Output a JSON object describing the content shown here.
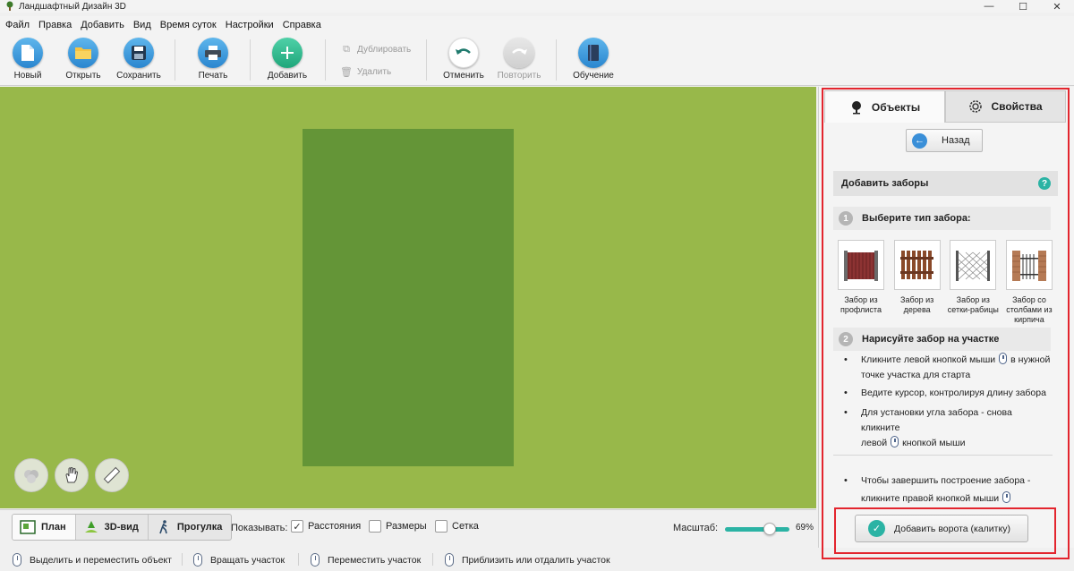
{
  "window": {
    "title": "Ландшафтный Дизайн 3D",
    "controls": [
      "—",
      "☐",
      "✕"
    ]
  },
  "menu": [
    "Файл",
    "Правка",
    "Добавить",
    "Вид",
    "Время суток",
    "Настройки",
    "Справка"
  ],
  "toolbar": {
    "new": "Новый",
    "open": "Открыть",
    "save": "Сохранить",
    "print": "Печать",
    "add": "Добавить",
    "duplicate": "Дублировать",
    "delete": "Удалить",
    "undo": "Отменить",
    "redo": "Повторить",
    "learn": "Обучение"
  },
  "bottombar": {
    "tabs": [
      "План",
      "3D-вид",
      "Прогулка"
    ],
    "show_label": "Показывать:",
    "checks": [
      {
        "label": "Расстояния",
        "checked": true
      },
      {
        "label": "Размеры",
        "checked": false
      },
      {
        "label": "Сетка",
        "checked": false
      }
    ],
    "scale_label": "Масштаб:",
    "scale_value": "69%",
    "scale_fraction": 0.69
  },
  "statusbar": [
    "Выделить и переместить объект",
    "Вращать участок",
    "Переместить участок",
    "Приблизить или отдалить участок"
  ],
  "panel": {
    "tab_objects": "Объекты",
    "tab_properties": "Свойства",
    "back": "Назад",
    "section_title": "Добавить заборы",
    "help": "?",
    "step1_num": "1",
    "step1_title": "Выберите тип забора:",
    "fences": [
      "Забор из профлиста",
      "Забор из дерева",
      "Забор из сетки-рабицы",
      "Забор со столбами из кирпича"
    ],
    "step2_num": "2",
    "step2_title": "Нарисуйте забор на участке",
    "bullet1_a": "Кликните левой кнопкой мыши",
    "bullet1_b": "в нужной точке участка для старта",
    "bullet2": "Ведите курсор, контролируя длину забора",
    "bullet3_a": "Для установки угла забора - снова кликните",
    "bullet3_b": "левой",
    "bullet3_c": "кнопкой мыши",
    "bullet4_a": "Чтобы завершить построение забора -",
    "bullet4_b": "кликните правой кнопкой мыши",
    "add_gate": "Добавить ворота (калитку)"
  },
  "colors": {
    "canvas": "#98b84a",
    "plot": "#649537",
    "accent": "#2bb3a4",
    "highlight": "#e3252e"
  }
}
